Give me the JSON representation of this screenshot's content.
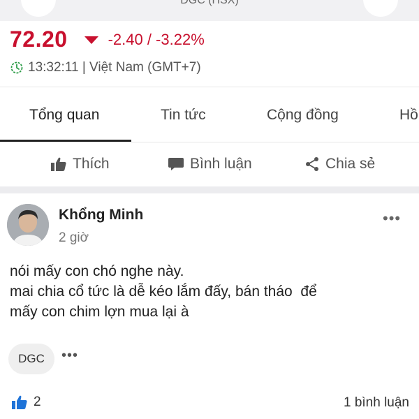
{
  "header": {
    "cut_title": "DGC (HSX)"
  },
  "quote": {
    "price": "72.20",
    "change": "-2.40 / -3.22%",
    "time": "13:32:11 | Việt Nam (GMT+7)",
    "color": "#c8102e"
  },
  "tabs": [
    {
      "label": "Tổng quan",
      "active": true
    },
    {
      "label": "Tin tức"
    },
    {
      "label": "Cộng đồng"
    },
    {
      "label": "Hồ"
    }
  ],
  "actions": {
    "like": "Thích",
    "comment": "Bình luận",
    "share": "Chia sẻ"
  },
  "post": {
    "author": "Khổng Minh",
    "time": "2 giờ",
    "lines": [
      "nói mấy con chó nghe này.",
      "mai chia cổ tức là dễ kéo lắm đấy, bán tháo  để",
      "mấy con chim lợn mua lại à"
    ],
    "tag": "DGC",
    "more": "•••",
    "likes": "2",
    "comments": "1 bình luận"
  }
}
